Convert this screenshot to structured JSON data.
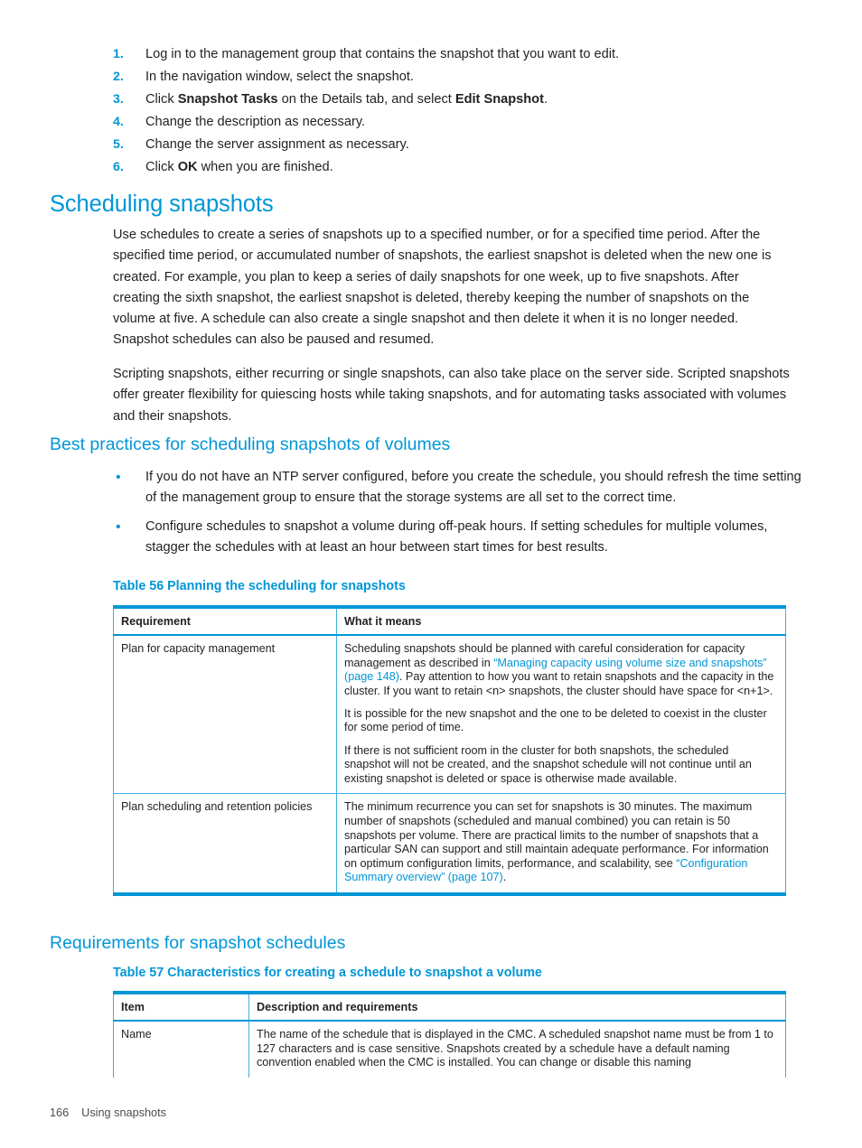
{
  "colors": {
    "accent_blue": "#0096d6",
    "table_rule": "#3eaee0",
    "body_text": "#231f20",
    "footer_text": "#4d4d4d"
  },
  "procedure": {
    "items": [
      {
        "num": "1.",
        "text_before": "Log in to the management group that contains the snapshot that you want to edit.",
        "bold1": "",
        "text_mid": "",
        "bold2": "",
        "text_after": ""
      },
      {
        "num": "2.",
        "text_before": "In the navigation window, select the snapshot.",
        "bold1": "",
        "text_mid": "",
        "bold2": "",
        "text_after": ""
      },
      {
        "num": "3.",
        "text_before": "Click ",
        "bold1": "Snapshot Tasks",
        "text_mid": " on the Details tab, and select ",
        "bold2": "Edit Snapshot",
        "text_after": "."
      },
      {
        "num": "4.",
        "text_before": "Change the description as necessary.",
        "bold1": "",
        "text_mid": "",
        "bold2": "",
        "text_after": ""
      },
      {
        "num": "5.",
        "text_before": "Change the server assignment as necessary.",
        "bold1": "",
        "text_mid": "",
        "bold2": "",
        "text_after": ""
      },
      {
        "num": "6.",
        "text_before": "Click ",
        "bold1": "OK",
        "text_mid": " when you are finished.",
        "bold2": "",
        "text_after": ""
      }
    ]
  },
  "sections": {
    "scheduling_snapshots": {
      "heading": "Scheduling snapshots",
      "paragraph_1": "Use schedules to create a series of snapshots up to a specified number, or for a specified time period. After the specified time period, or accumulated number of snapshots, the earliest snapshot is deleted when the new one is created. For example, you plan to keep a series of daily snapshots for one week, up to five snapshots. After creating the sixth snapshot, the earliest snapshot is deleted, thereby keeping the number of snapshots on the volume at five. A schedule can also create a single snapshot and then delete it when it is no longer needed. Snapshot schedules can also be paused and resumed.",
      "paragraph_2": "Scripting snapshots, either recurring or single snapshots, can also take place on the server side. Scripted snapshots offer greater flexibility for quiescing hosts while taking snapshots, and for automating tasks associated with volumes and their snapshots."
    },
    "best_practices": {
      "heading": "Best practices for scheduling snapshots of volumes",
      "bullets": [
        "If you do not have an NTP server configured, before you create the schedule, you should refresh the time setting of the management group to ensure that the storage systems are all set to the correct time.",
        "Configure schedules to snapshot a volume during off-peak hours. If setting schedules for multiple volumes, stagger the schedules with at least an hour between start times for best results."
      ]
    },
    "requirements": {
      "heading": "Requirements for snapshot schedules"
    }
  },
  "table_56": {
    "caption": "Table 56 Planning the scheduling for snapshots",
    "columns": [
      "Requirement",
      "What it means"
    ],
    "rows": [
      {
        "requirement": "Plan for capacity management",
        "paragraphs": [
          {
            "pre": "Scheduling snapshots should be planned with careful consideration for capacity management as described in ",
            "link": "“Managing capacity using volume size and snapshots” (page 148)",
            "post": ". Pay attention to how you want to retain snapshots and the capacity in the cluster. If you want to retain <n> snapshots, the cluster should have space for <n+1>."
          },
          {
            "pre": "It is possible for the new snapshot and the one to be deleted to coexist in the cluster for some period of time.",
            "link": "",
            "post": ""
          },
          {
            "pre": "If there is not sufficient room in the cluster for both snapshots, the scheduled snapshot will not be created, and the snapshot schedule will not continue until an existing snapshot is deleted or space is otherwise made available.",
            "link": "",
            "post": ""
          }
        ]
      },
      {
        "requirement": "Plan scheduling and retention policies",
        "paragraphs": [
          {
            "pre": "The minimum recurrence you can set for snapshots is 30 minutes. The maximum number of snapshots (scheduled and manual combined) you can retain is 50 snapshots per volume. There are practical limits to the number of snapshots that a particular SAN can support and still maintain adequate performance. For information on optimum configuration limits, performance, and scalability, see ",
            "link": "“Configuration Summary overview” (page 107)",
            "post": "."
          }
        ]
      }
    ]
  },
  "table_57": {
    "caption": "Table 57 Characteristics for creating a schedule to snapshot a volume",
    "columns": [
      "Item",
      "Description and requirements"
    ],
    "rows": [
      {
        "item": "Name",
        "paragraphs": [
          {
            "pre": "The name of the schedule that is displayed in the CMC. A scheduled snapshot name must be from 1 to 127 characters and is case sensitive. Snapshots created by a schedule have a default naming convention enabled when the CMC is installed. You can change or disable this naming",
            "link": "",
            "post": ""
          }
        ]
      }
    ]
  },
  "footer": {
    "page_number": "166",
    "chapter": "Using snapshots"
  }
}
